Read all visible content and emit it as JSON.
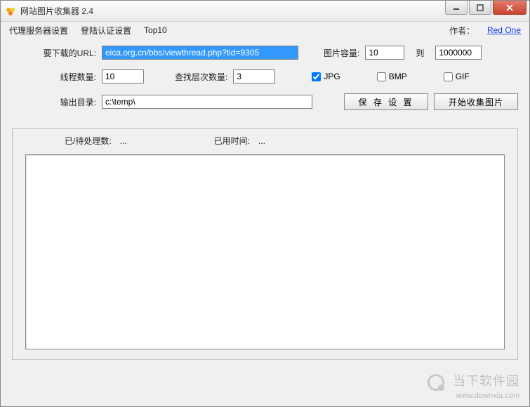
{
  "window": {
    "title": "网站图片收集器 2.4"
  },
  "menu": {
    "proxy": "代理服务器设置",
    "auth": "登陆认证设置",
    "top10": "Top10",
    "author_label": "作者：",
    "author_link": "Red One"
  },
  "form": {
    "url_label": "要下载的URL:",
    "url_value": "eica.org.cn/bbs/viewthread.php?tid=9305",
    "capacity_label": "图片容量:",
    "capacity_from": "10",
    "capacity_to_label": "到",
    "capacity_to": "1000000",
    "threads_label": "线程数量:",
    "threads_value": "10",
    "depth_label": "查找层次数量:",
    "depth_value": "3",
    "jpg_label": "JPG",
    "bmp_label": "BMP",
    "gif_label": "GIF",
    "outdir_label": "输出目录:",
    "outdir_value": "c:\\temp\\",
    "save_btn": "保 存 设 置",
    "start_btn": "开始收集图片"
  },
  "status": {
    "pending_label": "已/待处理数:",
    "pending_value": "...",
    "time_label": "已用时间:",
    "time_value": "..."
  },
  "watermark": {
    "brand": "当下软件园",
    "url": "www.downxia.com"
  }
}
